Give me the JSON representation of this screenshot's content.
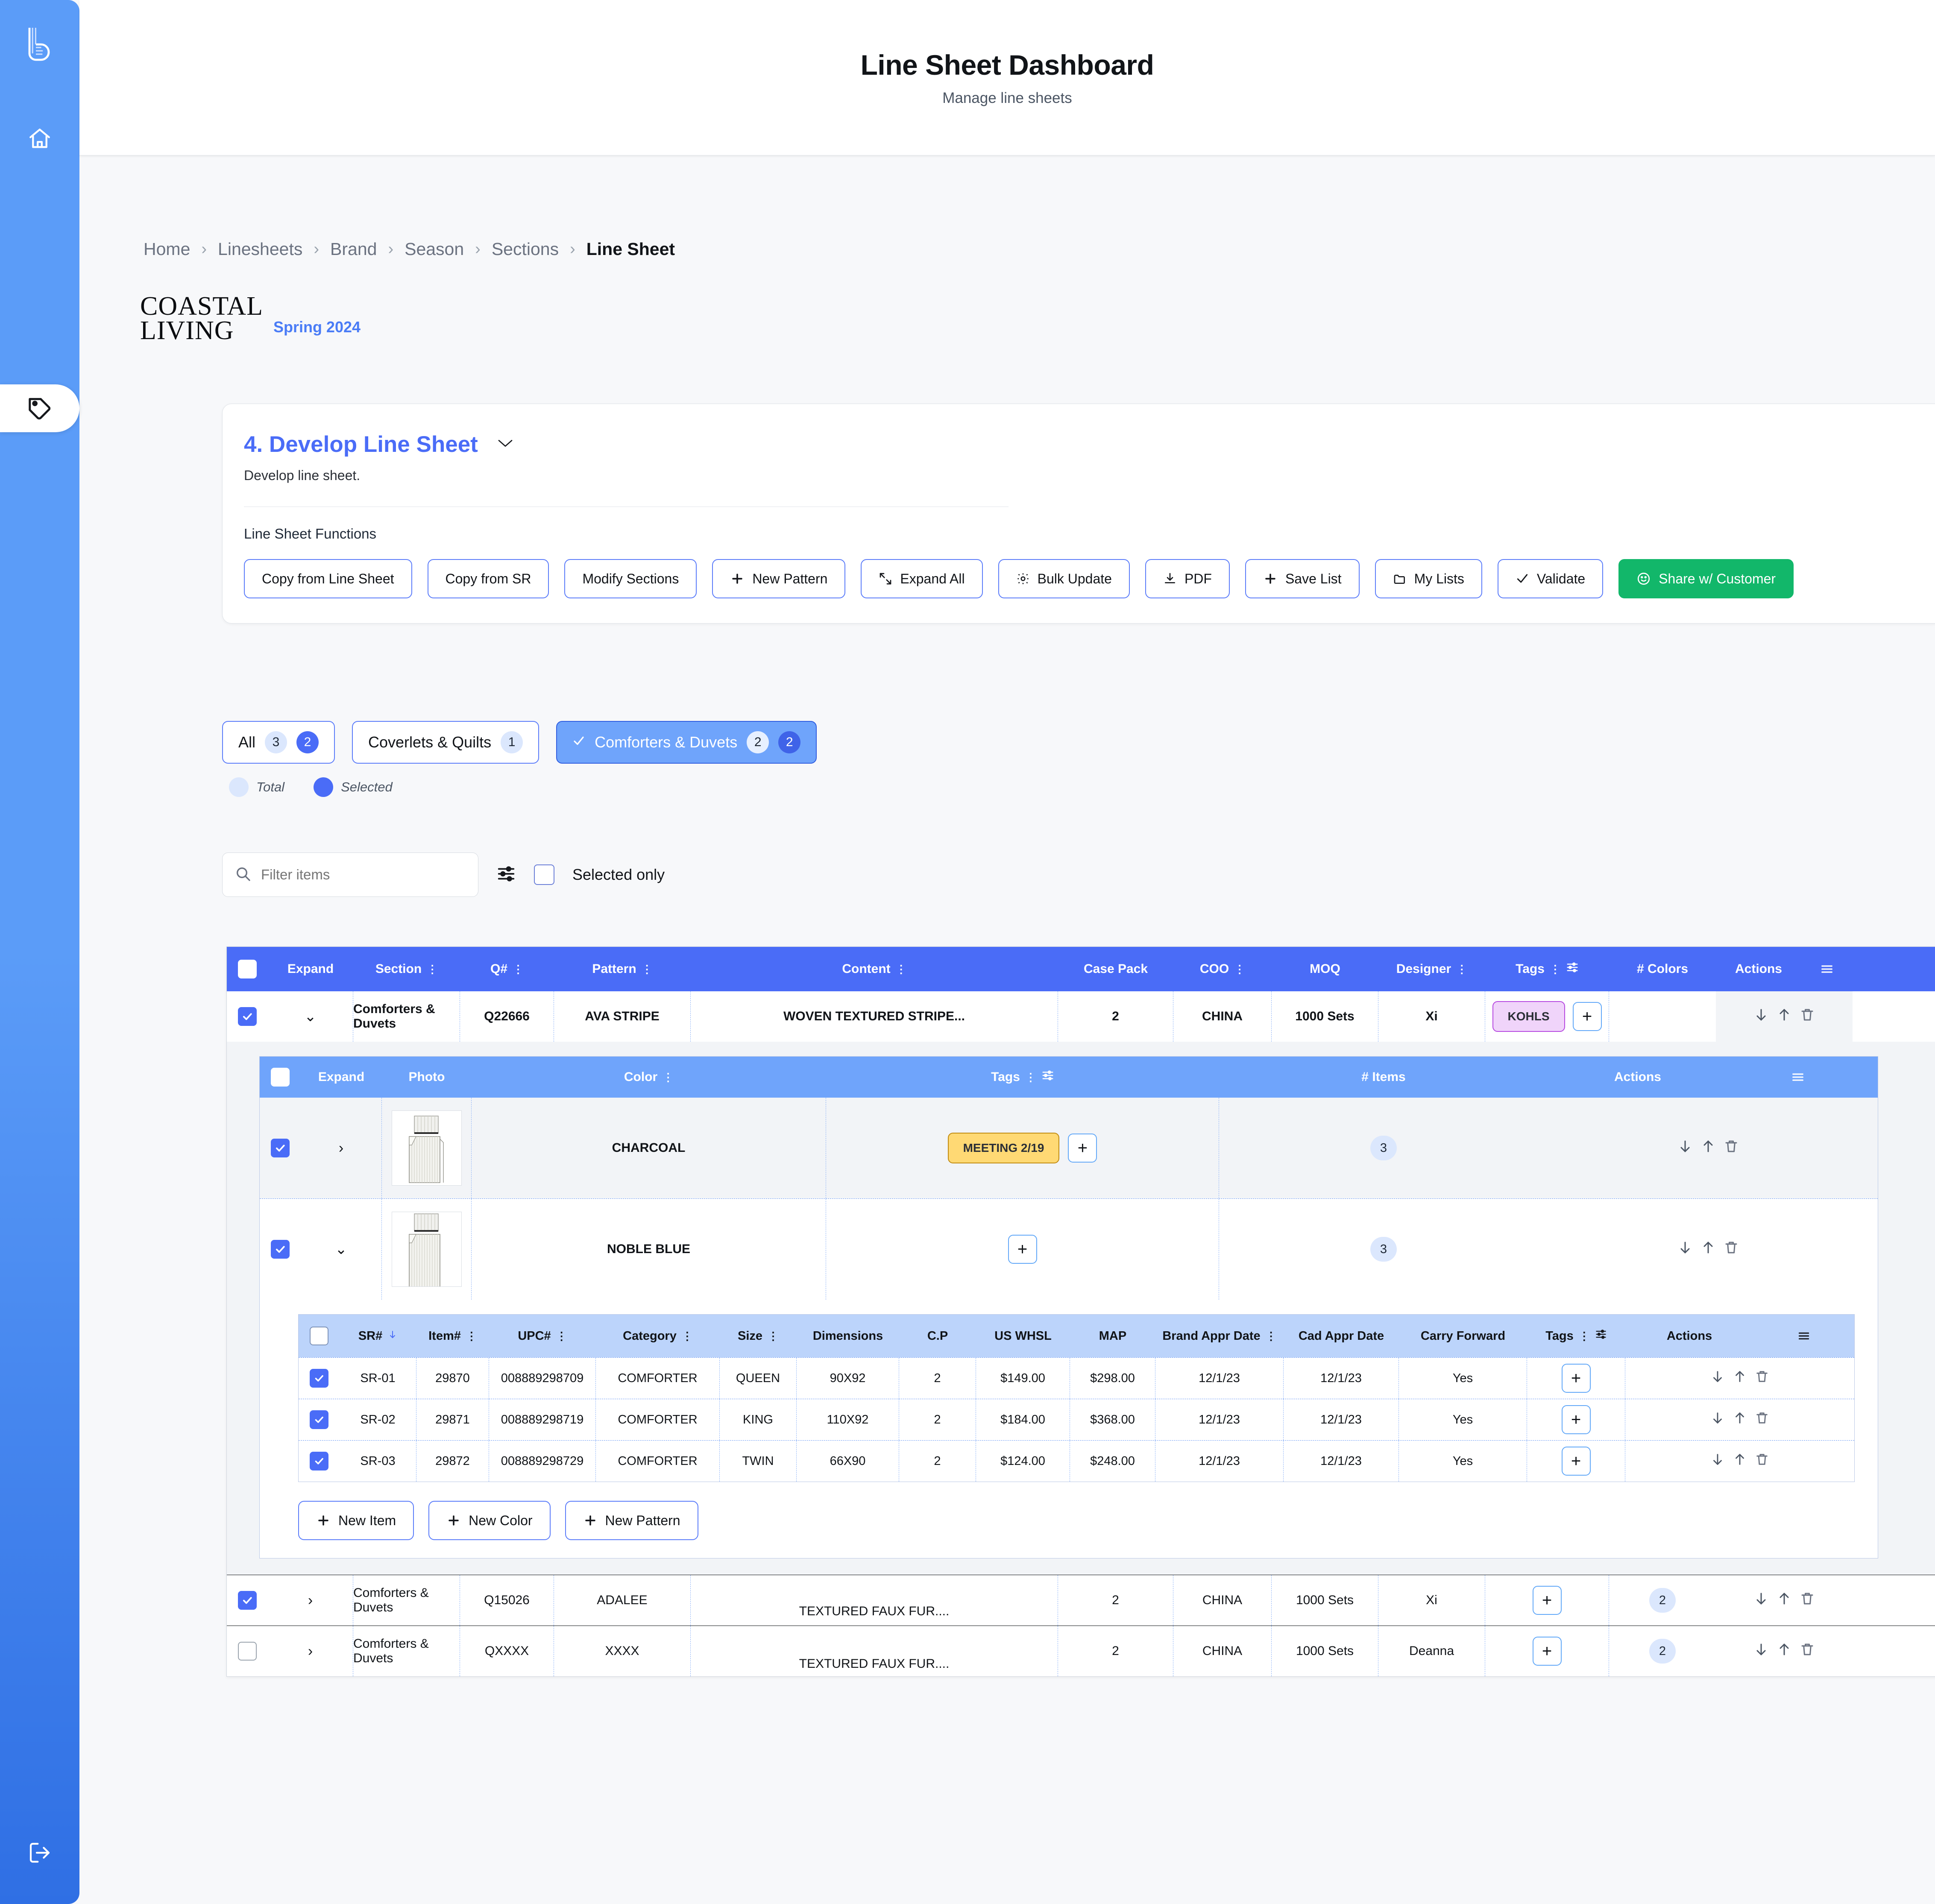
{
  "app": {
    "title": "Line Sheet Dashboard",
    "subtitle": "Manage line sheets"
  },
  "rail": {
    "logo_icon": "brand-logo-icon",
    "home_icon": "home-icon",
    "tag_icon": "tag-icon",
    "logout_icon": "logout-icon"
  },
  "breadcrumb": {
    "items": [
      "Home",
      "Linesheets",
      "Brand",
      "Season",
      "Sections",
      "Line Sheet"
    ],
    "separator": "›"
  },
  "brand": {
    "line1": "COASTAL",
    "line2": "LIVING",
    "season": "Spring 2024"
  },
  "panel": {
    "title": "4. Develop Line Sheet",
    "chevron": "chevron-down-icon",
    "description": "Develop line sheet.",
    "functions_label": "Line Sheet Functions",
    "buttons": [
      {
        "label": "Copy from Line Sheet",
        "icon": "",
        "style": "outline"
      },
      {
        "label": "Copy from SR",
        "icon": "",
        "style": "outline"
      },
      {
        "label": "Modify Sections",
        "icon": "",
        "style": "outline"
      },
      {
        "label": "New Pattern",
        "icon": "plus-icon",
        "style": "outline"
      },
      {
        "label": "Expand All",
        "icon": "expand-icon",
        "style": "outline"
      },
      {
        "label": "Bulk Update",
        "icon": "gear-icon",
        "style": "outline"
      },
      {
        "label": "PDF",
        "icon": "download-icon",
        "style": "outline"
      },
      {
        "label": "Save List",
        "icon": "plus-icon",
        "style": "outline"
      },
      {
        "label": "My Lists",
        "icon": "folder-icon",
        "style": "outline"
      },
      {
        "label": "Validate",
        "icon": "check-icon",
        "style": "outline"
      },
      {
        "label": "Share w/ Customer",
        "icon": "smiley-icon",
        "style": "green"
      }
    ]
  },
  "chips": [
    {
      "label": "All",
      "total": "3",
      "selected": "2",
      "active": false,
      "has_check": false
    },
    {
      "label": "Coverlets & Quilts",
      "total": "1",
      "selected": null,
      "active": false,
      "has_check": false
    },
    {
      "label": "Comforters & Duvets",
      "total": "2",
      "selected": "2",
      "active": true,
      "has_check": true
    }
  ],
  "legend": {
    "total_label": "Total",
    "selected_label": "Selected"
  },
  "filterbar": {
    "search_placeholder": "Filter items",
    "search_value": "",
    "search_icon": "search-icon",
    "sliders_icon": "sliders-icon",
    "selected_only_label": "Selected only",
    "selected_only_checked": false
  },
  "main_table": {
    "columns": [
      "Expand",
      "Section",
      "Q#",
      "Pattern",
      "Content",
      "Case Pack",
      "COO",
      "MOQ",
      "Designer",
      "Tags",
      "# Colors",
      "Actions"
    ],
    "menu_icon": "hamburger-icon",
    "rows": [
      {
        "checked": true,
        "expanded": true,
        "section": "Comforters & Duvets",
        "q": "Q22666",
        "pattern": "AVA STRIPE",
        "content": "WOVEN TEXTURED STRIPE...",
        "case_pack": "2",
        "coo": "CHINA",
        "moq": "1000 Sets",
        "designer": "Xi",
        "tags": [
          "KOHLS"
        ],
        "colors": ""
      },
      {
        "checked": true,
        "expanded": false,
        "section": "Comforters & Duvets",
        "q": "Q15026",
        "pattern": "ADALEE",
        "content": "TEXTURED FAUX FUR....",
        "case_pack": "2",
        "coo": "CHINA",
        "moq": "1000 Sets",
        "designer": "Xi",
        "tags": [],
        "colors": "2"
      },
      {
        "checked": false,
        "expanded": false,
        "section": "Comforters & Duvets",
        "q": "QXXXX",
        "pattern": "XXXX",
        "content": "TEXTURED FAUX FUR....",
        "case_pack": "2",
        "coo": "CHINA",
        "moq": "1000 Sets",
        "designer": "Deanna",
        "tags": [],
        "colors": "2"
      }
    ]
  },
  "color_table": {
    "columns": [
      "Expand",
      "Photo",
      "Color",
      "Tags",
      "# Items",
      "Actions"
    ],
    "menu_icon": "hamburger-icon",
    "rows": [
      {
        "checked": true,
        "expanded": false,
        "color": "CHARCOAL",
        "tags": [
          "MEETING 2/19"
        ],
        "items": "3"
      },
      {
        "checked": true,
        "expanded": true,
        "color": "NOBLE BLUE",
        "tags": [],
        "items": "3"
      }
    ]
  },
  "sku_table": {
    "columns": [
      "SR#",
      "Item#",
      "UPC#",
      "Category",
      "Size",
      "Dimensions",
      "C.P",
      "US WHSL",
      "MAP",
      "Brand Appr Date",
      "Cad Appr Date",
      "Carry Forward",
      "Tags",
      "Actions"
    ],
    "sort_column": "SR#",
    "sort_icon": "arrow-down-icon",
    "menu_icon": "hamburger-icon",
    "rows": [
      {
        "checked": true,
        "sr": "SR-01",
        "item": "29870",
        "upc": "008889298709",
        "category": "COMFORTER",
        "size": "QUEEN",
        "dimensions": "90X92",
        "cp": "2",
        "whsl": "$149.00",
        "map": "$298.00",
        "brand_appr": "12/1/23",
        "cad_appr": "12/1/23",
        "carry_forward": "Yes"
      },
      {
        "checked": true,
        "sr": "SR-02",
        "item": "29871",
        "upc": "008889298719",
        "category": "COMFORTER",
        "size": "KING",
        "dimensions": "110X92",
        "cp": "2",
        "whsl": "$184.00",
        "map": "$368.00",
        "brand_appr": "12/1/23",
        "cad_appr": "12/1/23",
        "carry_forward": "Yes"
      },
      {
        "checked": true,
        "sr": "SR-03",
        "item": "29872",
        "upc": "008889298729",
        "category": "COMFORTER",
        "size": "TWIN",
        "dimensions": "66X90",
        "cp": "2",
        "whsl": "$124.00",
        "map": "$248.00",
        "brand_appr": "12/1/23",
        "cad_appr": "12/1/23",
        "carry_forward": "Yes"
      }
    ],
    "footer_buttons": [
      {
        "label": "New Item",
        "icon": "plus-icon"
      },
      {
        "label": "New Color",
        "icon": "plus-icon"
      },
      {
        "label": "New Pattern",
        "icon": "plus-icon"
      }
    ]
  },
  "colors": {
    "accent": "#4a6cf7",
    "accent_light": "#6fa4fb",
    "green": "#12b76a",
    "tag_purple": "#f0d4fa",
    "tag_yellow": "#ffd974"
  }
}
